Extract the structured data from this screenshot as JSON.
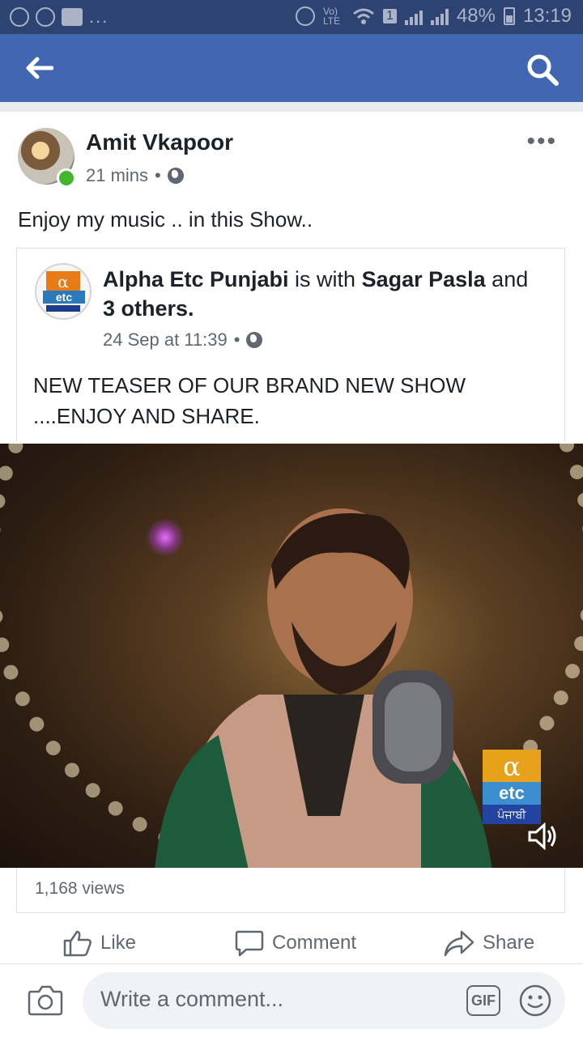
{
  "status_bar": {
    "battery": "48%",
    "time": "13:19",
    "network": "Vo) LTE",
    "sim": "1",
    "notification_dots": "..."
  },
  "post": {
    "author": "Amit Vkapoor",
    "time": "21 mins",
    "separator": "•",
    "text": "Enjoy my music .. in this Show..",
    "more": "•••"
  },
  "shared_post": {
    "page_name": "Alpha Etc Punjabi",
    "with_text": " is with ",
    "tagged": "Sagar Pasla",
    "and_text": " and ",
    "others": "3 others.",
    "time": "24 Sep at 11:39",
    "separator": "•",
    "text": "NEW TEASER OF OUR BRAND NEW SHOW ....ENJOY AND SHARE.",
    "logo": {
      "alpha": "α",
      "etc": "etc",
      "strip": "ਪੰਜਾਬੀ"
    }
  },
  "video": {
    "watermark": {
      "alpha": "α",
      "etc": "etc",
      "strip": "ਪੰਜਾਬੀ"
    }
  },
  "stats": {
    "views": "1,168 views"
  },
  "actions": {
    "like": "Like",
    "comment": "Comment",
    "share": "Share"
  },
  "composer": {
    "placeholder": "Write a comment...",
    "gif": "GIF"
  },
  "colors": {
    "facebook_blue": "#4267b2",
    "status_bar": "#2d4473",
    "online_green": "#42b72a"
  }
}
